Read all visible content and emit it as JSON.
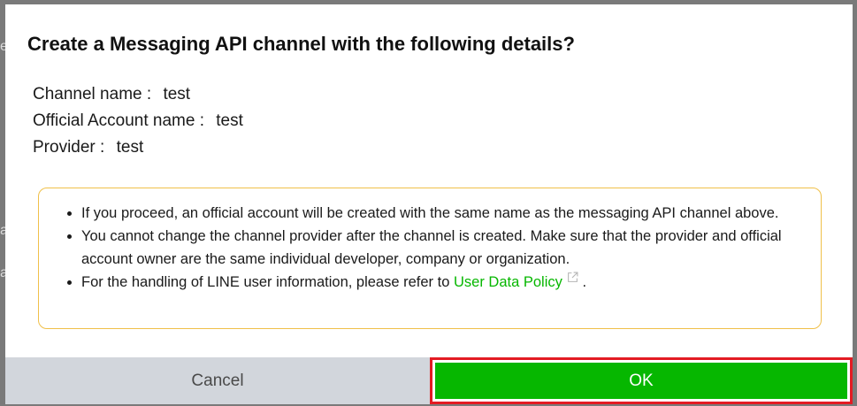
{
  "dialog": {
    "title": "Create a Messaging API channel with the following details?",
    "details": [
      {
        "label": "Channel name :",
        "value": "test"
      },
      {
        "label": "Official Account name :",
        "value": "test"
      },
      {
        "label": "Provider :",
        "value": "test"
      }
    ],
    "notices": {
      "item1": "If you proceed, an official account will be created with the same name as the messaging API channel above.",
      "item2": "You cannot change the channel provider after the channel is created. Make sure that the provider and official account owner are the same individual developer, company or organization.",
      "item3_prefix": "For the handling of LINE user information, please refer to",
      "item3_link": "User Data Policy",
      "item3_suffix": "."
    },
    "buttons": {
      "cancel": "Cancel",
      "ok": "OK"
    }
  },
  "colors": {
    "ok_button": "#06b700",
    "ok_highlight_border": "#e31b23",
    "cancel_button": "#d2d6dc",
    "notice_border": "#f0c04a",
    "link": "#06b700"
  },
  "icons": {
    "external_link": "external-link-icon"
  }
}
